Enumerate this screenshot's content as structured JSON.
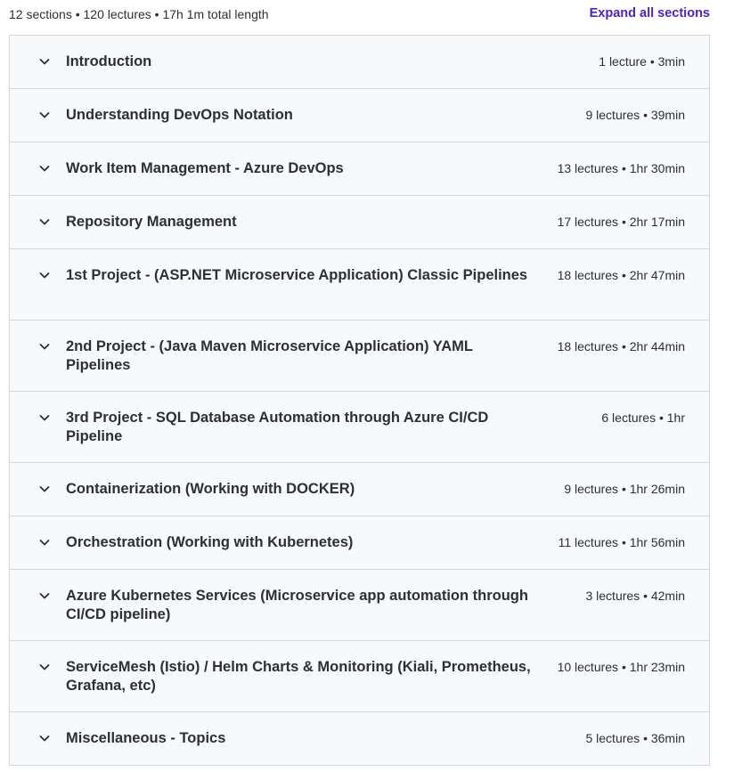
{
  "summary": {
    "text": "12 sections • 120 lectures • 17h 1m total length",
    "expand_label": "Expand all sections"
  },
  "colors": {
    "link": "#5022c3",
    "row_bg": "#f7f9fa",
    "border": "#d1d7dc",
    "text": "#2d2f31"
  },
  "icons": {
    "section_toggle": "chevron-down-icon"
  },
  "sections": [
    {
      "title": "Introduction",
      "meta": "1 lecture • 3min"
    },
    {
      "title": "Understanding DevOps Notation",
      "meta": "9 lectures • 39min"
    },
    {
      "title": "Work Item Management - Azure DevOps",
      "meta": "13 lectures • 1hr 30min"
    },
    {
      "title": "Repository Management",
      "meta": "17 lectures • 2hr 17min"
    },
    {
      "title": "1st Project - (ASP.NET Microservice Application) Classic Pipelines",
      "meta": "18 lectures • 2hr 47min"
    },
    {
      "title": "2nd Project - (Java Maven Microservice Application) YAML Pipelines",
      "meta": "18 lectures • 2hr 44min"
    },
    {
      "title": "3rd Project - SQL Database Automation through Azure CI/CD Pipeline",
      "meta": "6 lectures • 1hr"
    },
    {
      "title": "Containerization (Working with DOCKER)",
      "meta": "9 lectures • 1hr 26min"
    },
    {
      "title": "Orchestration (Working with Kubernetes)",
      "meta": "11 lectures • 1hr 56min"
    },
    {
      "title": "Azure Kubernetes Services (Microservice app automation through CI/CD pipeline)",
      "meta": "3 lectures • 42min"
    },
    {
      "title": "ServiceMesh (Istio) / Helm Charts & Monitoring (Kiali, Prometheus, Grafana, etc)",
      "meta": "10 lectures • 1hr 23min"
    },
    {
      "title": "Miscellaneous - Topics",
      "meta": "5 lectures • 36min"
    }
  ]
}
